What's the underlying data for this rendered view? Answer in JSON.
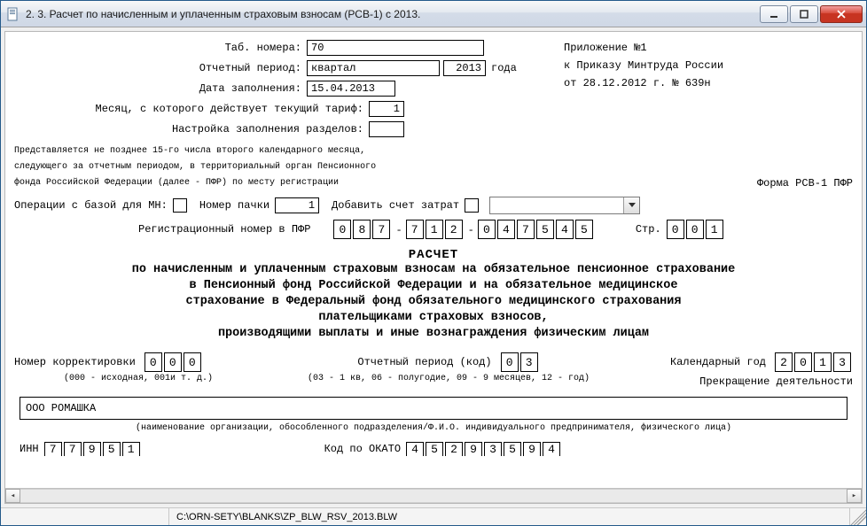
{
  "window": {
    "title": "2. 3. Расчет по начисленным и уплаченным страховым взносам (РСВ-1) с 2013."
  },
  "header": {
    "tab_number_label": "Таб. номера:",
    "tab_number_value": "70",
    "period_label": "Отчетный период:",
    "period_value": "квартал",
    "period_year_value": "2013",
    "period_year_suffix": "года",
    "fill_date_label": "Дата заполнения:",
    "fill_date_value": "15.04.2013",
    "tariff_month_label": "Месяц, с которого действует текущий тариф:",
    "tariff_month_value": "1",
    "sections_setup_label": "Настройка заполнения разделов:"
  },
  "sidebox": {
    "line1": "Приложение №1",
    "line2": "к Приказу Минтруда России",
    "line3": "от 28.12.2012 г. № 639н"
  },
  "note": {
    "l1": "Представляется не позднее 15-го числа второго календарного месяца,",
    "l2": "следующего за отчетным периодом, в территориальный орган Пенсионного",
    "l3": "фонда Российской Федерации (далее - ПФР) по месту регистрации"
  },
  "form_code_label": "Форма РСВ-1 ПФР",
  "ops": {
    "db_label": "Операции с базой для МН:",
    "pack_label": "Номер пачки",
    "pack_value": "1",
    "add_cost_label": "Добавить счет затрат",
    "reg_label": "Регистрационный номер в ПФР",
    "page_label": "Стр.",
    "reg_digits": [
      "0",
      "8",
      "7",
      "7",
      "1",
      "2",
      "0",
      "4",
      "7",
      "5",
      "4",
      "5"
    ],
    "page_digits": [
      "0",
      "0",
      "1"
    ]
  },
  "title": {
    "main": "РАСЧЕТ",
    "desc1": "по начисленным и уплаченным страховым взносам на обязательное пенсионное страхование",
    "desc2": "в Пенсионный фонд Российской Федерации и на обязательное медицинское",
    "desc3": "страхование в Федеральный фонд обязательного медицинского страхования",
    "desc4": "плательщиками страховых взносов,",
    "desc5": "производящими выплаты и иные вознаграждения физическим лицам"
  },
  "lower": {
    "corr_label": "Номер корректировки",
    "corr_digits": [
      "0",
      "0",
      "0"
    ],
    "corr_hint": "(000 - исходная, 001и т. д.)",
    "rp_label": "Отчетный период (код)",
    "rp_digits": [
      "0",
      "3"
    ],
    "rp_hint": "(03 - 1 кв, 06 - полугодие, 09 - 9 месяцев, 12 - год)",
    "year_label": "Календарный год",
    "year_digits": [
      "2",
      "0",
      "1",
      "3"
    ],
    "stop_label": "Прекращение деятельности"
  },
  "org": {
    "value": "ООО РОМАШКА",
    "caption": "(наименование организации, обособленного подразделения/Ф.И.О. индивидуального предпринимателя, физического лица)"
  },
  "bottom": {
    "inn_label": "ИНН",
    "inn_digits": [
      "7",
      "7",
      "9",
      "5",
      "1"
    ],
    "okato_label": "Код по ОКАТО",
    "okato_digits": [
      "4",
      "5",
      "2",
      "9",
      "3",
      "5",
      "9",
      "4"
    ]
  },
  "status": {
    "path": "C:\\ORN-SETY\\BLANKS\\ZP_BLW_RSV_2013.BLW"
  }
}
